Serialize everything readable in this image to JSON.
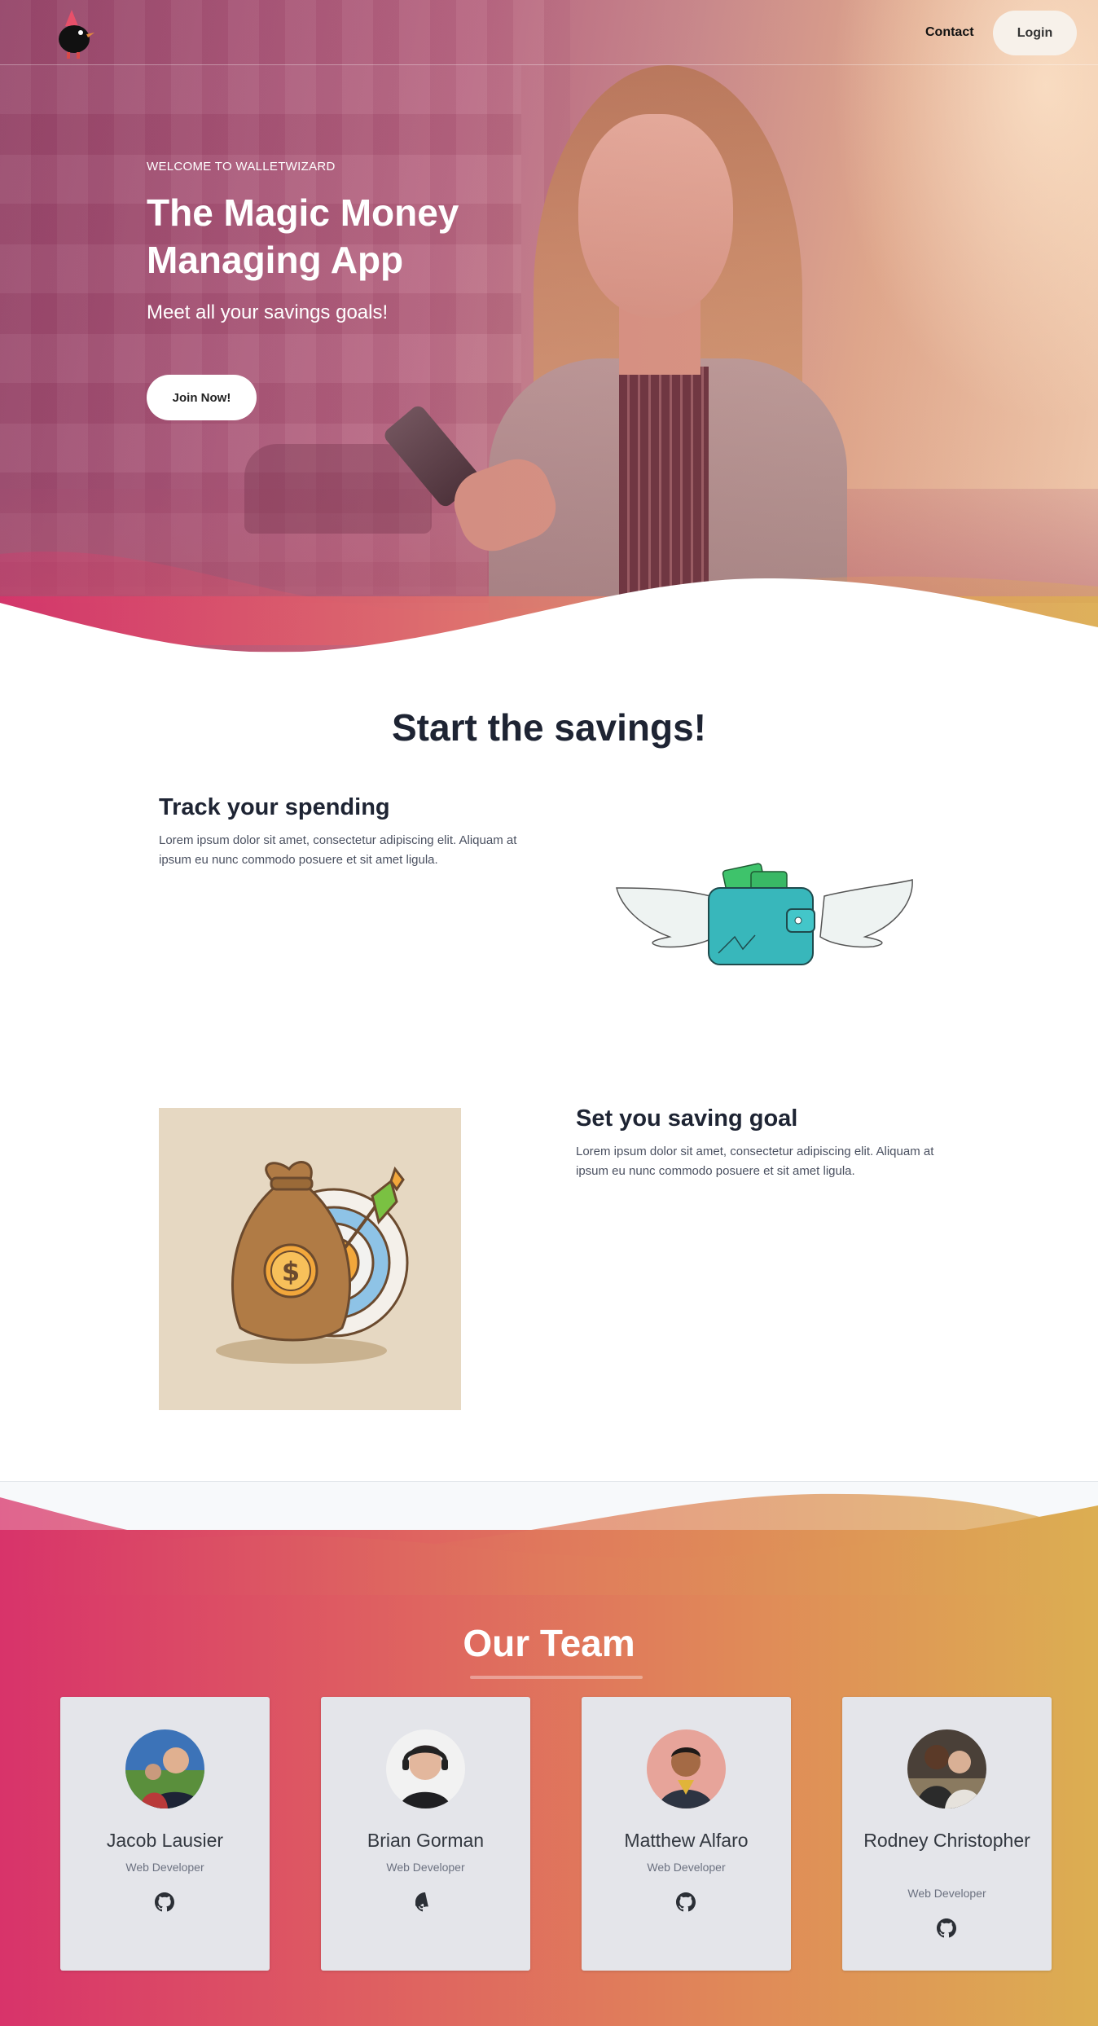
{
  "nav": {
    "brand": "WalletWizard",
    "contact_label": "Contact",
    "login_label": "Login"
  },
  "hero": {
    "kicker": "WELCOME TO WALLETWIZARD",
    "title": "The Magic Money Managing App",
    "subtitle": "Meet all your savings goals!",
    "cta_label": "Join Now!"
  },
  "savings": {
    "title": "Start the savings!",
    "features": [
      {
        "title": "Track your spending",
        "text": "Lorem ipsum dolor sit amet, consectetur adipiscing elit. Aliquam at ipsum eu nunc commodo posuere et sit amet ligula."
      },
      {
        "title": "Set you saving goal",
        "text": "Lorem ipsum dolor sit amet, consectetur adipiscing elit. Aliquam at ipsum eu nunc commodo posuere et sit amet ligula."
      }
    ]
  },
  "team": {
    "title": "Our Team",
    "members": [
      {
        "name": "Jacob Lausier",
        "role": "Web Developer",
        "icon": "github-icon"
      },
      {
        "name": "Brian Gorman",
        "role": "Web Developer",
        "icon": "github-icon"
      },
      {
        "name": "Matthew Alfaro",
        "role": "Web Developer",
        "icon": "github-icon"
      },
      {
        "name": "Rodney Christopher",
        "role": "Web Developer",
        "icon": "github-icon"
      }
    ]
  },
  "colors": {
    "pink": "#d8336a",
    "orange": "#e08a58",
    "gold": "#dcae52",
    "dark_text": "#1e2433",
    "card_bg": "#e4e5ea"
  }
}
